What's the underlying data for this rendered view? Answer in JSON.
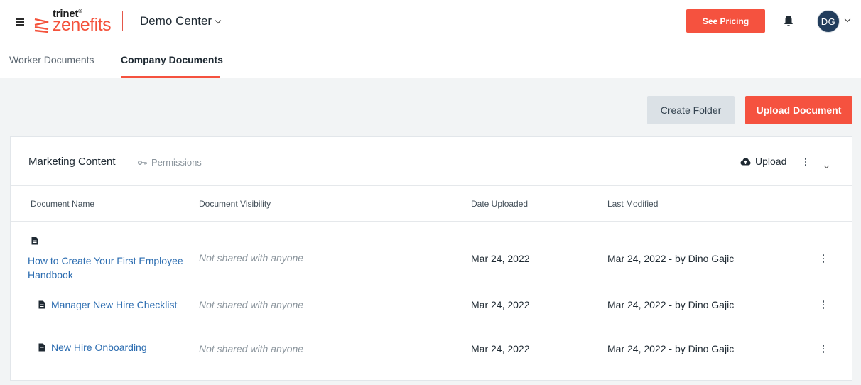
{
  "header": {
    "logo_small": "trinet",
    "logo_big": "zenefits",
    "company": "Demo Center",
    "pricing_label": "See Pricing",
    "avatar_initials": "DG"
  },
  "tabs": [
    {
      "label": "Worker Documents",
      "active": false
    },
    {
      "label": "Company Documents",
      "active": true
    }
  ],
  "toolbar": {
    "create_folder_label": "Create Folder",
    "upload_document_label": "Upload Document"
  },
  "folder": {
    "title": "Marketing Content",
    "permissions_label": "Permissions",
    "upload_label": "Upload"
  },
  "columns": [
    "Document Name",
    "Document Visibility",
    "Date Uploaded",
    "Last Modified"
  ],
  "documents": [
    {
      "name": "How to Create Your First Employee Handbook",
      "visibility": "Not shared with anyone",
      "uploaded": "Mar 24, 2022",
      "modified": "Mar 24, 2022 - by Dino Gajic"
    },
    {
      "name": "Manager New Hire Checklist",
      "visibility": "Not shared with anyone",
      "uploaded": "Mar 24, 2022",
      "modified": "Mar 24, 2022 - by Dino Gajic"
    },
    {
      "name": "New Hire Onboarding",
      "visibility": "Not shared with anyone",
      "uploaded": "Mar 24, 2022",
      "modified": "Mar 24, 2022 - by Dino Gajic"
    }
  ],
  "colors": {
    "accent": "#f5523f",
    "link": "#2b6cb0",
    "avatar_bg": "#223d5c",
    "page_bg": "#f2f4f5"
  },
  "icons": [
    "menu-icon",
    "zenefits-logo-icon",
    "chevron-down-icon",
    "bell-icon",
    "key-icon",
    "cloud-upload-icon",
    "kebab-menu-icon",
    "document-icon"
  ]
}
